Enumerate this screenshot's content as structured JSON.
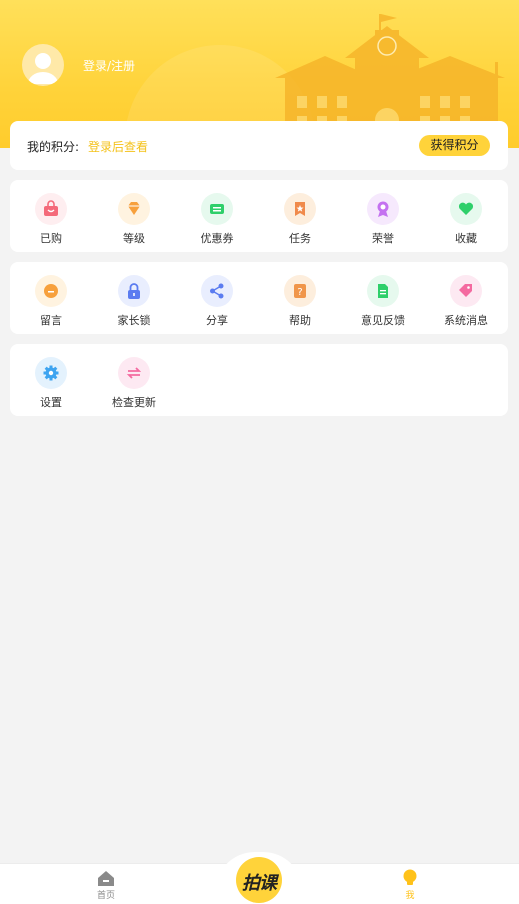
{
  "header": {
    "login_label": "登录/注册"
  },
  "points": {
    "label": "我的积分:",
    "link": "登录后查看",
    "button": "获得积分"
  },
  "menu": {
    "row1": [
      {
        "label": "已购",
        "icon": "shopping-bag-icon",
        "color": "#f46a7a"
      },
      {
        "label": "等级",
        "icon": "diamond-icon",
        "color": "#f7a03c"
      },
      {
        "label": "优惠券",
        "icon": "coupon-icon",
        "color": "#2ecf6a"
      },
      {
        "label": "任务",
        "icon": "task-bookmark-icon",
        "color": "#f08a4b"
      },
      {
        "label": "荣誉",
        "icon": "medal-icon",
        "color": "#c472f0"
      },
      {
        "label": "收藏",
        "icon": "heart-icon",
        "color": "#2ecf6a"
      }
    ],
    "row2": [
      {
        "label": "留言",
        "icon": "chat-icon",
        "color": "#f7a03c"
      },
      {
        "label": "家长锁",
        "icon": "lock-icon",
        "color": "#5b7cf0"
      },
      {
        "label": "分享",
        "icon": "share-icon",
        "color": "#5b7cf0"
      },
      {
        "label": "帮助",
        "icon": "help-icon",
        "color": "#f0964b"
      },
      {
        "label": "意见反馈",
        "icon": "feedback-document-icon",
        "color": "#2ecf6a"
      },
      {
        "label": "系统消息",
        "icon": "message-tag-icon",
        "color": "#f46aa0"
      }
    ],
    "row3": [
      {
        "label": "设置",
        "icon": "gear-icon",
        "color": "#3ea4f0"
      },
      {
        "label": "检查更新",
        "icon": "refresh-arrows-icon",
        "color": "#f46aa0"
      }
    ]
  },
  "tabbar": {
    "home_label": "首页",
    "center_label": "拍课",
    "me_label": "我",
    "inactive_color": "#8a8a8a",
    "active_color": "#ffc21a"
  }
}
